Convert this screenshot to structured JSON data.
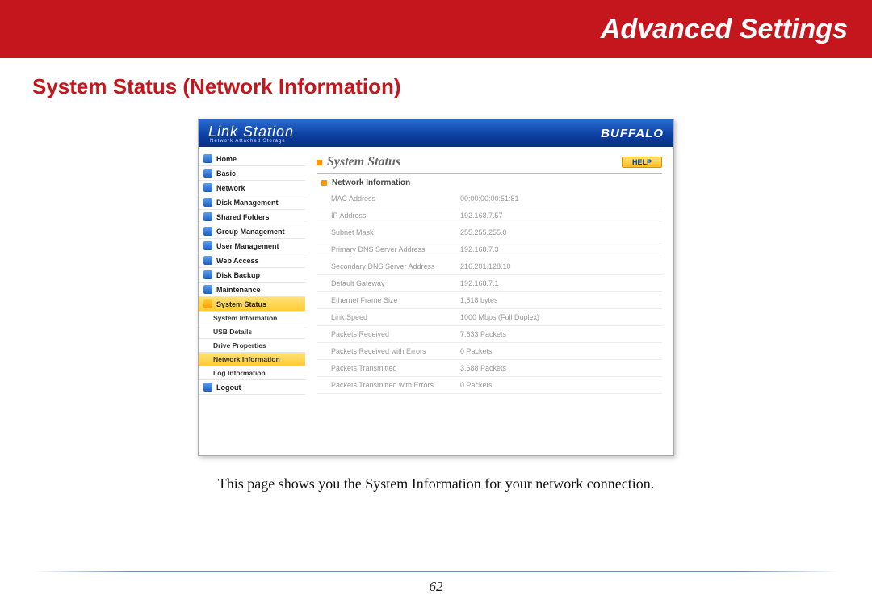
{
  "banner": {
    "title": "Advanced Settings"
  },
  "section_title": "System Status (Network Information)",
  "app": {
    "brand_left": "Link Station",
    "brand_left_sub": "Network Attached Storage",
    "brand_right": "BUFFALO",
    "content_title": "System Status",
    "help_label": "HELP",
    "subsection_title": "Network Information"
  },
  "nav": {
    "items": [
      {
        "label": "Home",
        "icon": "blue"
      },
      {
        "label": "Basic",
        "icon": "blue"
      },
      {
        "label": "Network",
        "icon": "blue"
      },
      {
        "label": "Disk Management",
        "icon": "blue"
      },
      {
        "label": "Shared Folders",
        "icon": "blue"
      },
      {
        "label": "Group Management",
        "icon": "blue"
      },
      {
        "label": "User Management",
        "icon": "blue"
      },
      {
        "label": "Web Access",
        "icon": "blue"
      },
      {
        "label": "Disk Backup",
        "icon": "blue"
      },
      {
        "label": "Maintenance",
        "icon": "blue"
      },
      {
        "label": "System Status",
        "icon": "orange",
        "active": true
      }
    ],
    "sub_items": [
      {
        "label": "System Information"
      },
      {
        "label": "USB Details"
      },
      {
        "label": "Drive Properties"
      },
      {
        "label": "Network Information",
        "active": true
      },
      {
        "label": "Log Information"
      }
    ],
    "logout": {
      "label": "Logout",
      "icon": "blue"
    }
  },
  "network_info": [
    {
      "label": "MAC Address",
      "value": "00:00:00:00:51:81"
    },
    {
      "label": "IP Address",
      "value": "192.168.7.57"
    },
    {
      "label": "Subnet Mask",
      "value": "255.255.255.0"
    },
    {
      "label": "Primary DNS Server Address",
      "value": "192.168.7.3"
    },
    {
      "label": "Secondary DNS Server Address",
      "value": "216.201.128.10"
    },
    {
      "label": "Default Gateway",
      "value": "192.168.7.1"
    },
    {
      "label": "Ethernet Frame Size",
      "value": "1,518 bytes"
    },
    {
      "label": "Link Speed",
      "value": "1000 Mbps (Full Duplex)"
    },
    {
      "label": "Packets Received",
      "value": "7,633 Packets"
    },
    {
      "label": "Packets Received with Errors",
      "value": "0 Packets"
    },
    {
      "label": "Packets Transmitted",
      "value": "3,688 Packets"
    },
    {
      "label": "Packets Transmitted with Errors",
      "value": "0 Packets"
    }
  ],
  "caption": "This page shows you the System Information for your network connection.",
  "page_number": "62"
}
